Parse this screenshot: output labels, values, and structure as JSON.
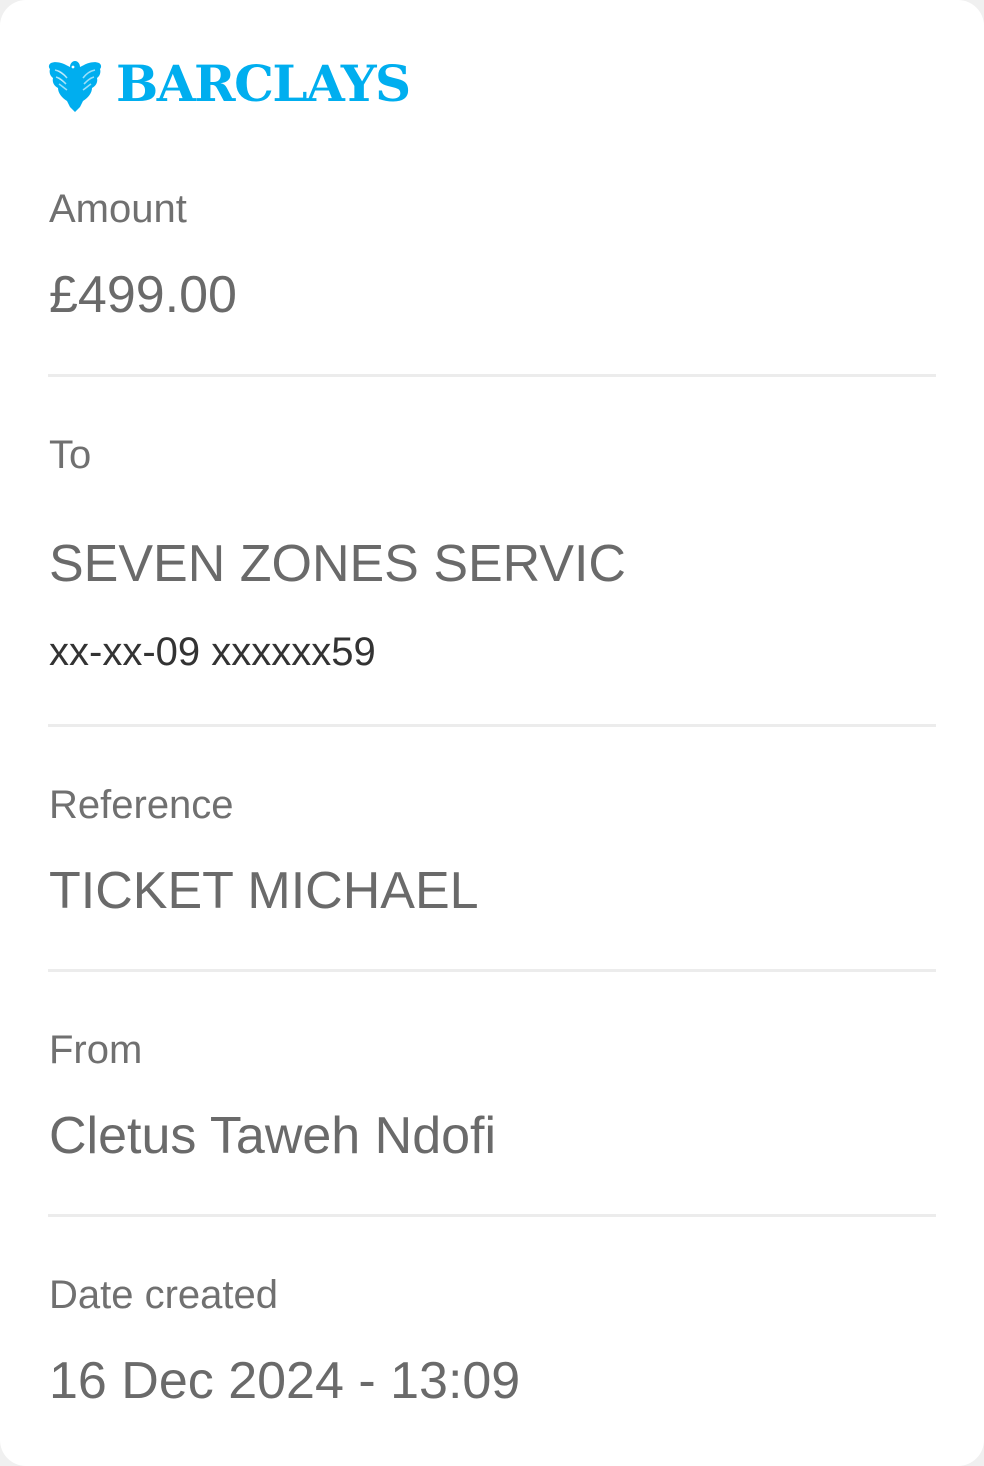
{
  "brand": {
    "name": "BARCLAYS",
    "color": "#00aeef",
    "icon": "eagle-icon"
  },
  "details": {
    "amount": {
      "label": "Amount",
      "value": "£499.00"
    },
    "to": {
      "label": "To",
      "name": "SEVEN ZONES SERVIC",
      "account": "xx-xx-09 xxxxxx59"
    },
    "reference": {
      "label": "Reference",
      "value": "TICKET MICHAEL"
    },
    "from": {
      "label": "From",
      "value": "Cletus Taweh Ndofi"
    },
    "date_created": {
      "label": "Date created",
      "value": "16 Dec 2024 - 13:09"
    }
  }
}
